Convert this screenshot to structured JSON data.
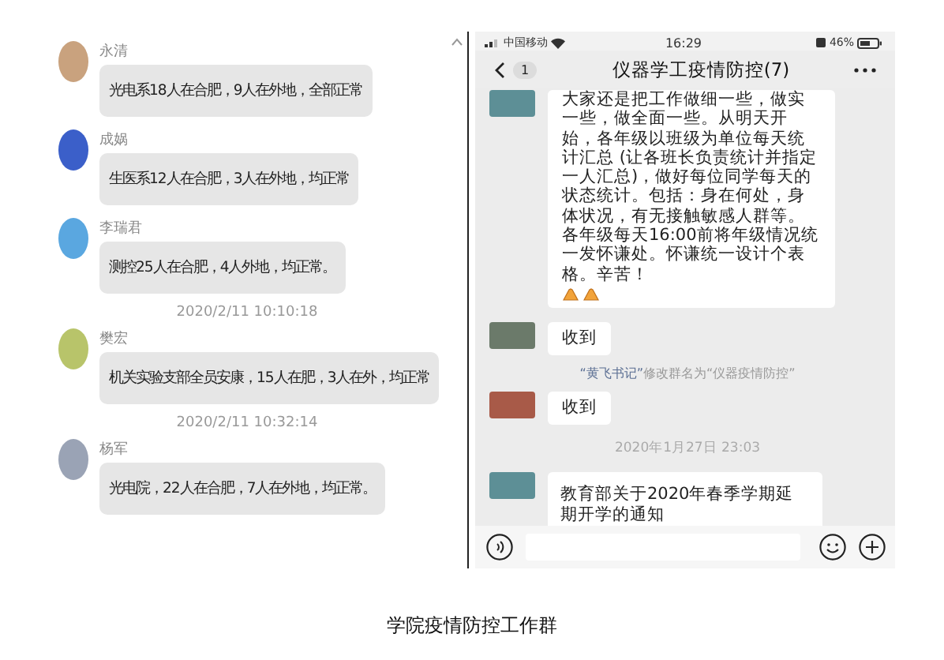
{
  "left_chat": {
    "messages": [
      {
        "kind": "message",
        "sender": "永清",
        "text": "光电系18人在合肥，9人在外地，全部正常"
      },
      {
        "kind": "message",
        "sender": "成娲",
        "text": "生医系12人在合肥，3人在外地，均正常"
      },
      {
        "kind": "message",
        "sender": "李瑞君",
        "text": "测控25人在合肥，4人外地，均正常。"
      },
      {
        "kind": "time",
        "text": "2020/2/11 10:10:18"
      },
      {
        "kind": "message",
        "sender": "樊宏",
        "text": "机关实验支部全员安康，15人在肥，3人在外，均正常"
      },
      {
        "kind": "time",
        "text": "2020/2/11 10:32:14"
      },
      {
        "kind": "message",
        "sender": "杨军",
        "text": "光电院，22人在合肥，7人在外地，均正常。"
      }
    ]
  },
  "phone": {
    "status_bar": {
      "carrier": "中国移动",
      "time": "16:29",
      "battery": "46%"
    },
    "header": {
      "unread": "1",
      "title": "仪器学工疫情防控(7)"
    },
    "messages": [
      {
        "kind": "text_emoji",
        "text": "大家还是把工作做细一些，做实一些，做全面一些。从明天开始，各年级以班级为单位每天统计汇总 (让各班长负责统计并指定一人汇总)，做好每位同学每天的状态统计。包括：身在何处，身体状况，有无接触敏感人群等。各年级每天16:00前将年级情况统一发怀谦处。怀谦统一设计个表格。辛苦！"
      },
      {
        "kind": "text",
        "text": "收到"
      },
      {
        "kind": "system",
        "actor": "“黄飞书记”",
        "text": "修改群名为“仪器疫情防控”"
      },
      {
        "kind": "text",
        "text": "收到"
      },
      {
        "kind": "time",
        "text": "2020年1月27日 23:03"
      },
      {
        "kind": "card",
        "text": "教育部关于2020年春季学期延期开学的通知"
      }
    ]
  },
  "caption": "学院疫情防控工作群"
}
